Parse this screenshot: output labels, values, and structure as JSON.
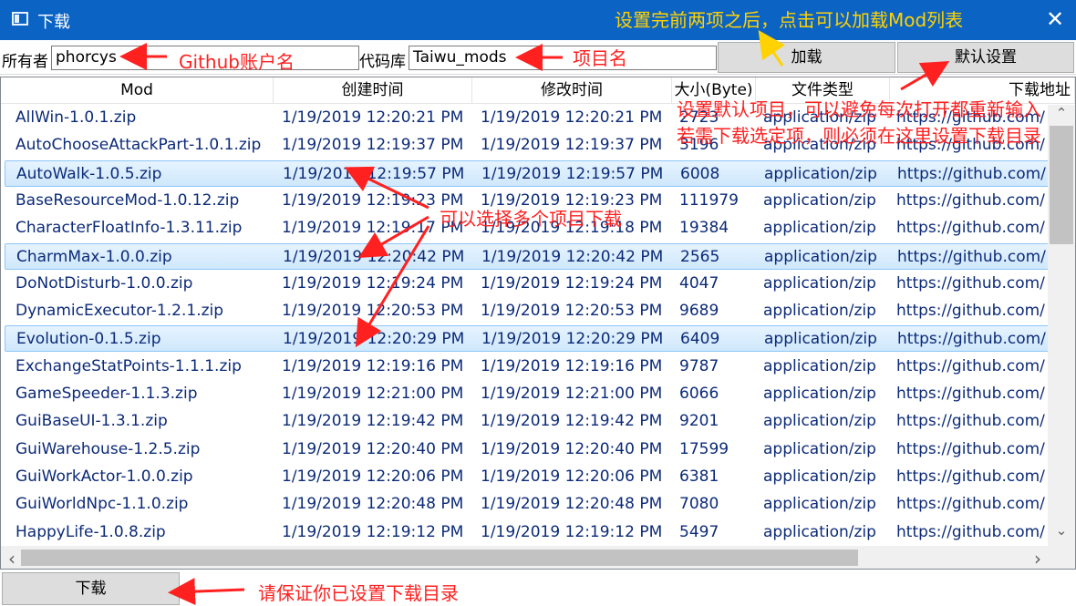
{
  "window": {
    "title": "下载",
    "close_glyph": "✕",
    "icon": "window-icon"
  },
  "toolbar": {
    "owner_label": "所有者",
    "owner_value": "phorcys",
    "repo_label": "代码库",
    "repo_value": "Taiwu_mods",
    "load_button": "加载",
    "default_button": "默认设置"
  },
  "annotations": {
    "top": "设置完前两项之后，点击可以加载Mod列表",
    "owner": "Github账户名",
    "repo": "项目名",
    "default_line1": "设置默认项目，可以避免每次打开都重新输入",
    "default_line2": "若需下载选定项，则必须在这里设置下载目录",
    "multi": "可以选择多个项目下载",
    "bottom": "请保证你已设置下载目录"
  },
  "table": {
    "headers": [
      "Mod",
      "创建时间",
      "修改时间",
      "大小(Byte)",
      "文件类型",
      "下载地址"
    ],
    "rows": [
      {
        "mod": "AllWin-1.0.1.zip",
        "created": "1/19/2019 12:20:21 PM",
        "modified": "1/19/2019 12:20:21 PM",
        "size": "2723",
        "type": "application/zip",
        "url": "https://github.com/",
        "selected": false
      },
      {
        "mod": "AutoChooseAttackPart-1.0.1.zip",
        "created": "1/19/2019 12:19:37 PM",
        "modified": "1/19/2019 12:19:37 PM",
        "size": "3196",
        "type": "application/zip",
        "url": "https://github.com/",
        "selected": false
      },
      {
        "mod": "AutoWalk-1.0.5.zip",
        "created": "1/19/2019 12:19:57 PM",
        "modified": "1/19/2019 12:19:57 PM",
        "size": "6008",
        "type": "application/zip",
        "url": "https://github.com/",
        "selected": true
      },
      {
        "mod": "BaseResourceMod-1.0.12.zip",
        "created": "1/19/2019 12:19:23 PM",
        "modified": "1/19/2019 12:19:23 PM",
        "size": "111979",
        "type": "application/zip",
        "url": "https://github.com/",
        "selected": false
      },
      {
        "mod": "CharacterFloatInfo-1.3.11.zip",
        "created": "1/19/2019 12:19:17 PM",
        "modified": "1/19/2019 12:19:18 PM",
        "size": "19384",
        "type": "application/zip",
        "url": "https://github.com/",
        "selected": false
      },
      {
        "mod": "CharmMax-1.0.0.zip",
        "created": "1/19/2019 12:20:42 PM",
        "modified": "1/19/2019 12:20:42 PM",
        "size": "2565",
        "type": "application/zip",
        "url": "https://github.com/",
        "selected": true
      },
      {
        "mod": "DoNotDisturb-1.0.0.zip",
        "created": "1/19/2019 12:19:24 PM",
        "modified": "1/19/2019 12:19:24 PM",
        "size": "4047",
        "type": "application/zip",
        "url": "https://github.com/",
        "selected": false
      },
      {
        "mod": "DynamicExecutor-1.2.1.zip",
        "created": "1/19/2019 12:20:53 PM",
        "modified": "1/19/2019 12:20:53 PM",
        "size": "9689",
        "type": "application/zip",
        "url": "https://github.com/",
        "selected": false
      },
      {
        "mod": "Evolution-0.1.5.zip",
        "created": "1/19/2019 12:20:29 PM",
        "modified": "1/19/2019 12:20:29 PM",
        "size": "6409",
        "type": "application/zip",
        "url": "https://github.com/",
        "selected": true
      },
      {
        "mod": "ExchangeStatPoints-1.1.1.zip",
        "created": "1/19/2019 12:19:16 PM",
        "modified": "1/19/2019 12:19:16 PM",
        "size": "9787",
        "type": "application/zip",
        "url": "https://github.com/",
        "selected": false
      },
      {
        "mod": "GameSpeeder-1.1.3.zip",
        "created": "1/19/2019 12:21:00 PM",
        "modified": "1/19/2019 12:21:00 PM",
        "size": "6066",
        "type": "application/zip",
        "url": "https://github.com/",
        "selected": false
      },
      {
        "mod": "GuiBaseUI-1.3.1.zip",
        "created": "1/19/2019 12:19:42 PM",
        "modified": "1/19/2019 12:19:42 PM",
        "size": "9201",
        "type": "application/zip",
        "url": "https://github.com/",
        "selected": false
      },
      {
        "mod": "GuiWarehouse-1.2.5.zip",
        "created": "1/19/2019 12:20:40 PM",
        "modified": "1/19/2019 12:20:40 PM",
        "size": "17599",
        "type": "application/zip",
        "url": "https://github.com/",
        "selected": false
      },
      {
        "mod": "GuiWorkActor-1.0.0.zip",
        "created": "1/19/2019 12:20:06 PM",
        "modified": "1/19/2019 12:20:06 PM",
        "size": "6381",
        "type": "application/zip",
        "url": "https://github.com/",
        "selected": false
      },
      {
        "mod": "GuiWorldNpc-1.1.0.zip",
        "created": "1/19/2019 12:20:48 PM",
        "modified": "1/19/2019 12:20:48 PM",
        "size": "7080",
        "type": "application/zip",
        "url": "https://github.com/",
        "selected": false
      },
      {
        "mod": "HappyLife-1.0.8.zip",
        "created": "1/19/2019 12:19:12 PM",
        "modified": "1/19/2019 12:19:12 PM",
        "size": "5497",
        "type": "application/zip",
        "url": "https://github.com/",
        "selected": false
      }
    ]
  },
  "scrollbars": {
    "up": "⌃",
    "down": "⌄",
    "left": "‹",
    "right": "›"
  },
  "footer": {
    "download_button": "下载"
  },
  "colors": {
    "titlebar": "#0b63c4",
    "annotation_red": "#ff2020",
    "annotation_yellow": "#ffd200",
    "selection": "#cfe8fc"
  }
}
